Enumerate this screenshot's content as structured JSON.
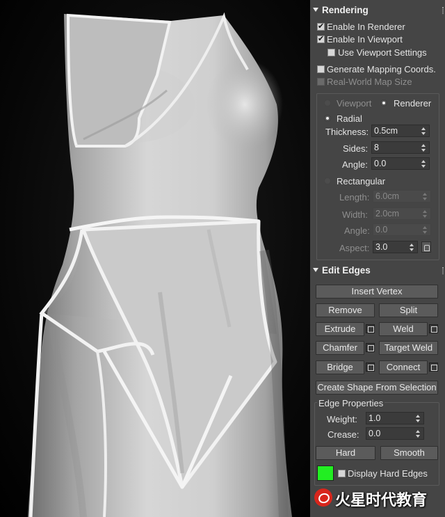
{
  "rendering": {
    "title": "Rendering",
    "enable_in_renderer": {
      "label": "Enable In Renderer",
      "checked": true
    },
    "enable_in_viewport": {
      "label": "Enable In Viewport",
      "checked": true
    },
    "use_viewport_settings": {
      "label": "Use Viewport Settings",
      "checked": false
    },
    "generate_mapping": {
      "label": "Generate Mapping Coords.",
      "checked": false
    },
    "real_world_map": {
      "label": "Real-World Map Size",
      "checked": false,
      "disabled": true
    },
    "viewport_radio": "Viewport",
    "renderer_radio": "Renderer",
    "radial": {
      "label": "Radial",
      "thickness": {
        "label": "Thickness:",
        "value": "0.5cm"
      },
      "sides": {
        "label": "Sides:",
        "value": "8"
      },
      "angle": {
        "label": "Angle:",
        "value": "0.0"
      }
    },
    "rectangular": {
      "label": "Rectangular",
      "length": {
        "label": "Length:",
        "value": "6.0cm"
      },
      "width": {
        "label": "Width:",
        "value": "2.0cm"
      },
      "angle": {
        "label": "Angle:",
        "value": "0.0"
      },
      "aspect": {
        "label": "Aspect:",
        "value": "3.0"
      }
    }
  },
  "edit_edges": {
    "title": "Edit Edges",
    "insert_vertex": "Insert Vertex",
    "remove": "Remove",
    "split": "Split",
    "extrude": "Extrude",
    "weld": "Weld",
    "chamfer": "Chamfer",
    "target_weld": "Target Weld",
    "bridge": "Bridge",
    "connect": "Connect",
    "create_shape": "Create Shape From Selection",
    "edge_properties": {
      "title": "Edge Properties",
      "weight": {
        "label": "Weight:",
        "value": "1.0"
      },
      "crease": {
        "label": "Crease:",
        "value": "0.0"
      },
      "hard": "Hard",
      "smooth": "Smooth",
      "display_hard_edges": {
        "label": "Display Hard Edges",
        "checked": false
      },
      "swatch_color": "#22ee22"
    }
  },
  "watermark": {
    "text": "火星时代教育"
  },
  "icons": [
    "rollout-collapse-icon",
    "settings-square-icon",
    "lock-icon",
    "watermark-logo-icon"
  ]
}
